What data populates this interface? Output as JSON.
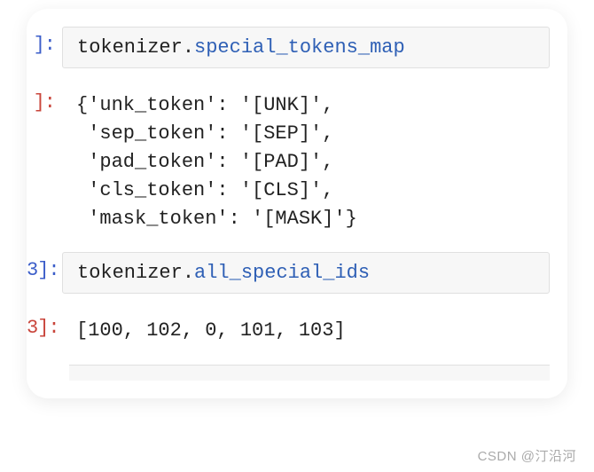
{
  "cells": {
    "cell1": {
      "prompt_suffix": "]:",
      "obj": "tokenizer.",
      "attr": "special_tokens_map"
    },
    "out1": {
      "prompt_suffix": "]:",
      "text": "{'unk_token': '[UNK]',\n 'sep_token': '[SEP]',\n 'pad_token': '[PAD]',\n 'cls_token': '[CLS]',\n 'mask_token': '[MASK]'}"
    },
    "cell2": {
      "prompt_suffix": "]:",
      "prompt_num_hint": "3",
      "obj": "tokenizer.",
      "attr": "all_special_ids"
    },
    "out2": {
      "prompt_suffix": "]:",
      "prompt_num_hint": "3",
      "text": "[100, 102, 0, 101, 103]"
    }
  },
  "chart_data": {
    "special_tokens_map": {
      "unk_token": "[UNK]",
      "sep_token": "[SEP]",
      "pad_token": "[PAD]",
      "cls_token": "[CLS]",
      "mask_token": "[MASK]"
    },
    "all_special_ids": [
      100,
      102,
      0,
      101,
      103
    ]
  },
  "watermark": "CSDN @汀沿河"
}
